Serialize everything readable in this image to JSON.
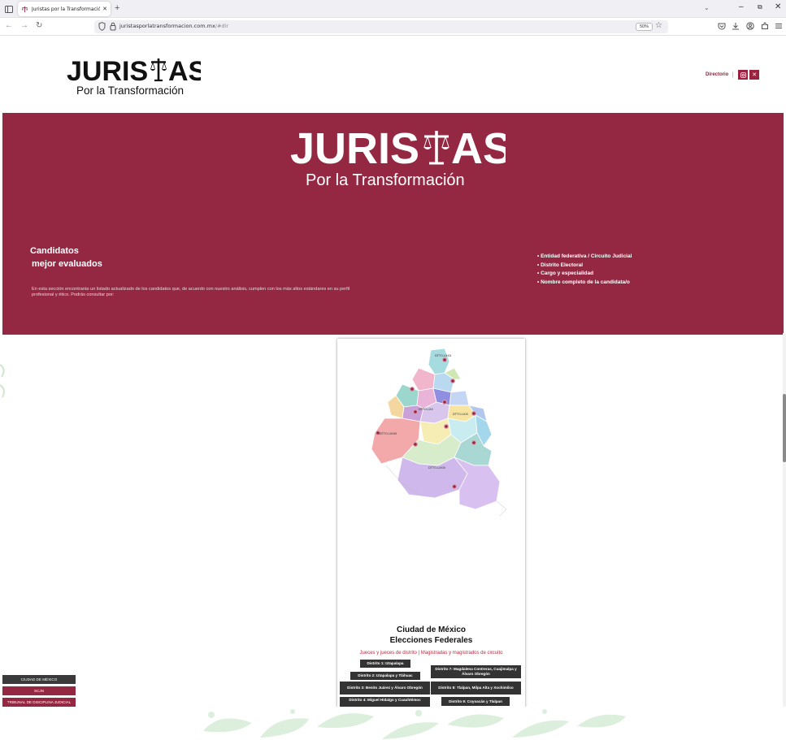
{
  "browser": {
    "tab": {
      "title": "Juristas por la Transformación - Dir"
    },
    "url": {
      "domain": "juristasporlatransformacion.com.mx",
      "path": "/#dir"
    },
    "zoom": "50%",
    "icons": [
      "sidebar-icon",
      "back-icon",
      "forward-icon",
      "reload-icon",
      "shield-icon",
      "lock-icon",
      "bookmark-star-icon",
      "pocket-icon",
      "download-icon",
      "account-icon",
      "extensions-icon",
      "menu-icon"
    ]
  },
  "site": {
    "logo": {
      "word_left": "JURIS",
      "word_right": "AS",
      "tagline": "Por la Transformación"
    },
    "nav": {
      "directory": "Directorio",
      "separator": "|",
      "socials": [
        "instagram-icon",
        "x-icon"
      ]
    }
  },
  "hero": {
    "logo": {
      "word_left": "JURIS",
      "word_right": "AS",
      "tagline": "Por la Transformación"
    },
    "heading_line1": "Candidatos",
    "heading_line2": "mejor evaluados",
    "description": "En esta sección encontrarás un listado actualizado de los candidatos que, de acuerdo con nuestro análisis, cumplen con los más altos estándares en su perfil profesional y ético. Podrás consultar por:",
    "criteria": [
      "• Entidad federativa / Circuito Judicial",
      "• Distrito Electoral",
      "• Cargo y especialidad",
      "• Nombre completo de la candidata/o"
    ]
  },
  "card": {
    "map_labels": [
      "DTTO.LXXX",
      "DTTO.LXX",
      "DTTO.LXXI",
      "DTTO.LXXIII",
      "DTTO.LXXIV"
    ],
    "title_line1": "Ciudad de México",
    "title_line2": "Elecciones Federales",
    "subtitle": "Jueces y jueces de distrito | Magistradas y magistrados de circuito",
    "districts": [
      "Distrito 1: Iztapalapa",
      "Distrito 2: Iztapalapa y Tláhuac",
      "Distrito 7: Magdalena Contreras, Cuajimalpa y Álvaro Obregón",
      "Distrito 3: Benito Juárez y Álvaro Obregón",
      "Distrito 8: Tlalpan, Milpa Alta y Xochimilco",
      "Distrito 4: Miguel Hidalgo y Cuauhtémoc",
      "Distrito 9: Coyoacán y Tlalpan"
    ]
  },
  "side_buttons": [
    {
      "label": "CIUDAD DE MÉXICO",
      "color": "#3a3a3a"
    },
    {
      "label": "SCJN",
      "color": "#942842"
    },
    {
      "label": "TRIBUNAL DE DISCIPLINA JUDICIAL",
      "color": "#942842"
    }
  ],
  "colors": {
    "brand": "#942842",
    "accent_red": "#c2263d",
    "dark": "#333333"
  }
}
